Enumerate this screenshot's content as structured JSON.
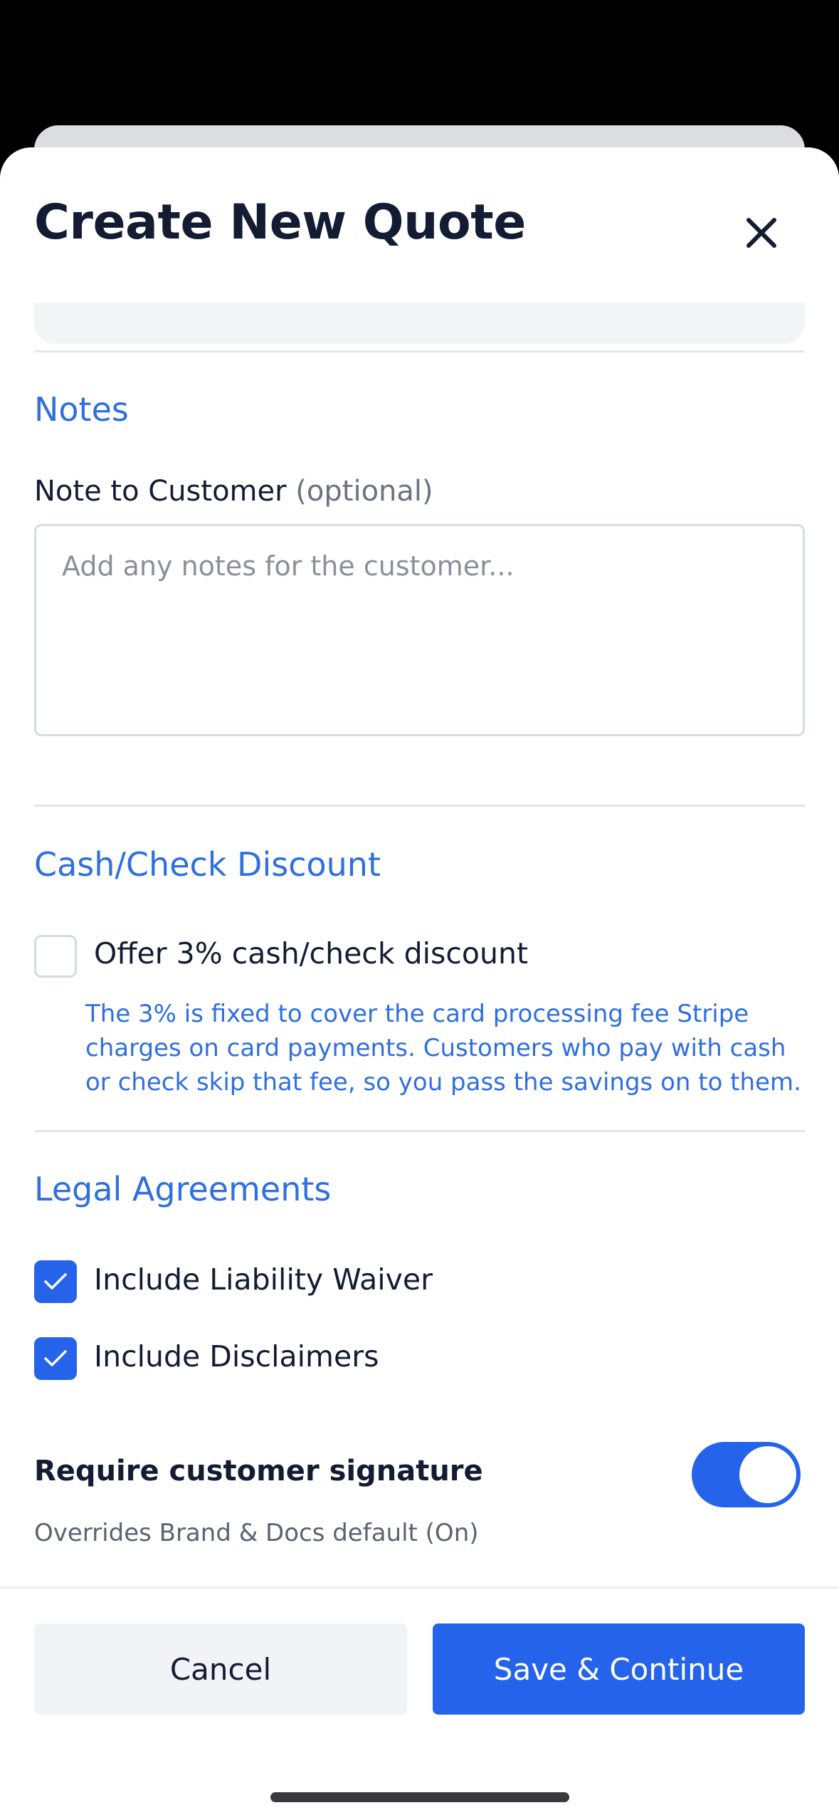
{
  "sheet": {
    "title": "Create New Quote"
  },
  "notes": {
    "section_title": "Notes",
    "field_label": "Note to Customer",
    "field_optional": "(optional)",
    "value": "",
    "placeholder": "Add any notes for the customer..."
  },
  "discount": {
    "section_title": "Cash/Check Discount",
    "checkbox_label": "Offer 3% cash/check discount",
    "checked": false,
    "help_text": "The 3% is fixed to cover the card processing fee Stripe charges on card payments. Customers who pay with cash or check skip that fee, so you pass the savings on to them."
  },
  "legal": {
    "section_title": "Legal Agreements",
    "items": [
      {
        "label": "Include Liability Waiver",
        "checked": true
      },
      {
        "label": "Include Disclaimers",
        "checked": true
      }
    ]
  },
  "signature": {
    "title": "Require customer signature",
    "subtitle": "Overrides Brand & Docs default (On)",
    "enabled": true
  },
  "footer": {
    "cancel_label": "Cancel",
    "save_label": "Save & Continue"
  },
  "colors": {
    "accent": "#2563eb",
    "section_title": "#2f6fe0",
    "text_primary": "#131c33"
  },
  "icons": {
    "close": "close-icon",
    "check": "checkmark-icon"
  }
}
